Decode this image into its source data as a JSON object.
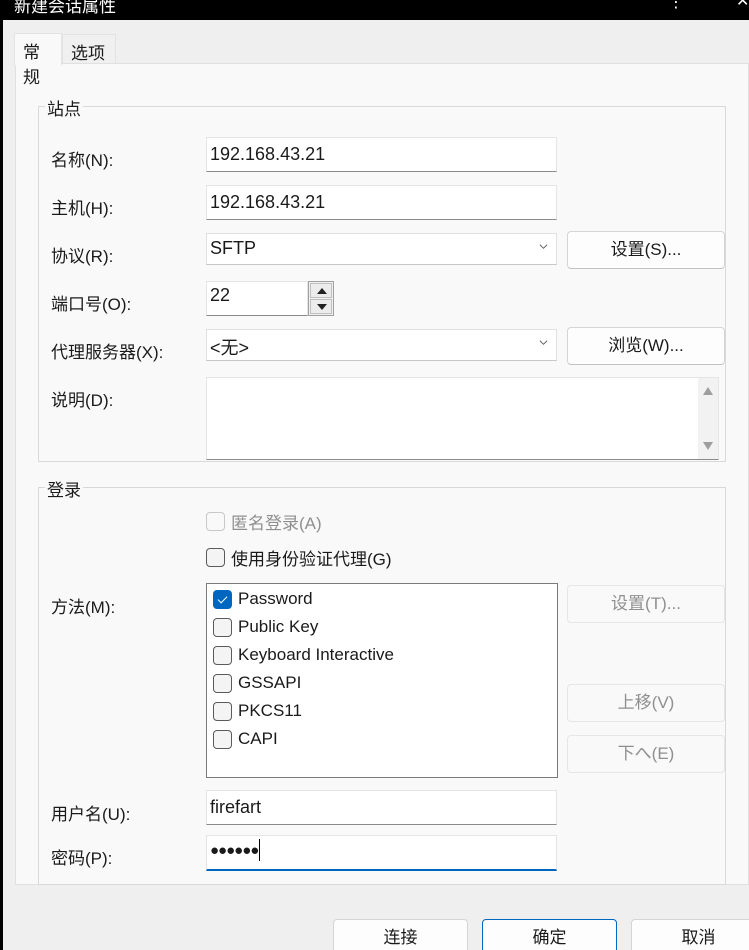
{
  "window": {
    "title": "新建会话属性",
    "more_icon": "⋮",
    "close_icon": "✕"
  },
  "tabs": [
    {
      "label": "常规",
      "active": true
    },
    {
      "label": "选项",
      "active": false
    }
  ],
  "site_group": {
    "title": "站点",
    "name": {
      "label": "名称(N):",
      "value": "192.168.43.21"
    },
    "host": {
      "label": "主机(H):",
      "value": "192.168.43.21"
    },
    "protocol": {
      "label": "协议(R):",
      "value": "SFTP",
      "settings_button": "设置(S)..."
    },
    "port": {
      "label": "端口号(O):",
      "value": "22"
    },
    "proxy": {
      "label": "代理服务器(X):",
      "value": "<无>",
      "browse_button": "浏览(W)..."
    },
    "description": {
      "label": "说明(D):",
      "value": ""
    }
  },
  "login_group": {
    "title": "登录",
    "anonymous": {
      "label": "匿名登录(A)",
      "checked": false,
      "disabled": true
    },
    "use_agent": {
      "label": "使用身份验证代理(G)",
      "checked": false,
      "disabled": false
    },
    "method": {
      "label": "方法(M):",
      "options": [
        {
          "label": "Password",
          "checked": true
        },
        {
          "label": "Public Key",
          "checked": false
        },
        {
          "label": "Keyboard Interactive",
          "checked": false
        },
        {
          "label": "GSSAPI",
          "checked": false
        },
        {
          "label": "PKCS11",
          "checked": false
        },
        {
          "label": "CAPI",
          "checked": false
        }
      ],
      "settings_button": "设置(T)...",
      "move_up_button": "上移(V)",
      "move_down_button": "下へ(E)"
    },
    "username": {
      "label": "用户名(U):",
      "value": "firefart"
    },
    "password": {
      "label": "密码(P):",
      "value": "●●●●●●"
    }
  },
  "footer": {
    "connect_button": "连接",
    "ok_button": "确定",
    "cancel_button": "取消"
  },
  "colors": {
    "accent": "#0067c0",
    "titlebar": "#000000"
  }
}
